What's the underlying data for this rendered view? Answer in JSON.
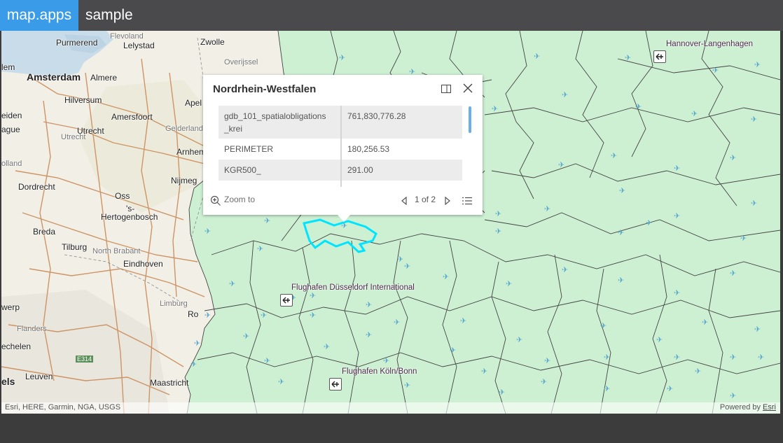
{
  "header": {
    "brand": "map.apps",
    "title": "sample"
  },
  "map": {
    "labels": {
      "purmerend": "Purmerend",
      "flevoland": "Flevoland",
      "lelystad": "Lelystad",
      "zwolle": "Zwolle",
      "overijssel": "Overijssel",
      "elem": "lem",
      "amsterdam": "Amsterdam",
      "almere": "Almere",
      "hilversum": "Hilversum",
      "amersfoort": "Amersfoort",
      "apel": "Apel",
      "leiden": "eiden",
      "ague": "ague",
      "utrecht": "Utrecht",
      "utrecht2": "Utrecht",
      "gelderland": "Gelderland",
      "arnhem": "Arnhem",
      "olland": "olland",
      "dordrecht": "Dordrecht",
      "nijmegen": "Nijmeg",
      "oss": "Oss",
      "s": "'s-",
      "hertogenbosch": "Hertogenbosch",
      "breda": "Breda",
      "tilburg": "Tilburg",
      "northbrabant": "North Brabant",
      "eindhoven": "Eindhoven",
      "werp": "werp",
      "limburg": "Limburg",
      "ro": "Ro",
      "flanders": "Flanders",
      "echelen": "echelen",
      "e314": "E314",
      "leuven": "Leuven",
      "els": "els",
      "maastricht": "Maastricht",
      "hannover": "Hannover-Langenhagen",
      "dusseldorf": "Flughafen Düsseldorf International",
      "koeln": "Flughafen Köln/Bonn"
    },
    "attribution": "Esri, HERE, Garmin, NGA, USGS",
    "powered_prefix": "Powered by ",
    "powered_link": "Esri"
  },
  "popup": {
    "title": "Nordrhein-Westfalen",
    "rows": [
      {
        "key": "gdb_101_spatialobligations",
        "key2": "_krei",
        "value": "761,830,776.28"
      },
      {
        "key": "PERIMETER",
        "value": "180,256.53"
      },
      {
        "key": "KGR500_",
        "value": "291.00"
      }
    ],
    "zoom_label": "Zoom to",
    "pager": "1 of 2"
  },
  "colors": {
    "brand": "#3a9be8",
    "header": "#4a4a4c",
    "region_fill": "#cdf0d2",
    "highlight": "#00e5ff"
  },
  "icons": {
    "dock": "dock-icon",
    "close": "close-icon",
    "zoom": "zoom-in-icon",
    "prev": "chevron-left-icon",
    "next": "chevron-right-icon",
    "list": "list-icon",
    "airport": "airport-icon"
  }
}
